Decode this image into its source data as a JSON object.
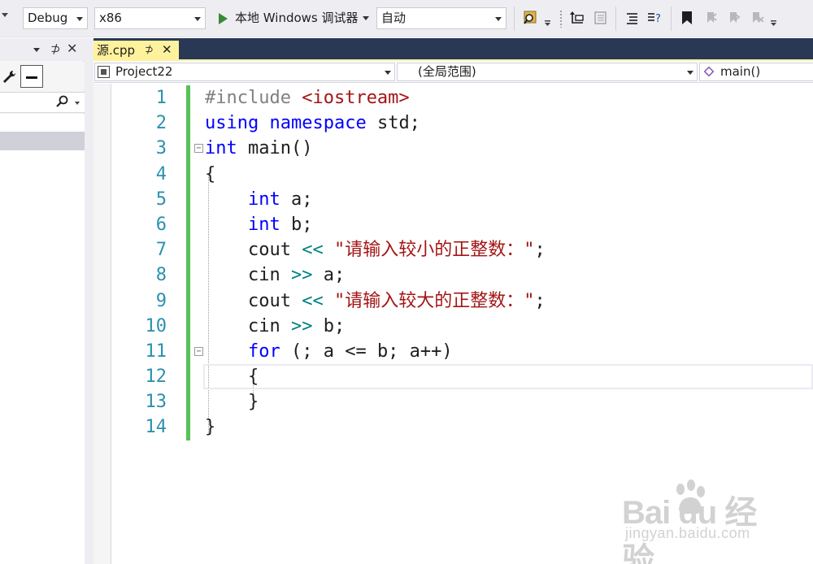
{
  "toolbar": {
    "config": "Debug",
    "platform": "x86",
    "run_label": "本地 Windows 调试器",
    "mode": "自动"
  },
  "tab": {
    "filename": "源.cpp",
    "pin": "⊅",
    "close": "✕"
  },
  "navbar": {
    "project": "Project22",
    "scope": "(全局范围)",
    "member": "main()"
  },
  "left_panel": {
    "pin": "⊅",
    "close": "✕"
  },
  "editor": {
    "line_numbers": [
      "1",
      "2",
      "3",
      "4",
      "5",
      "6",
      "7",
      "8",
      "9",
      "10",
      "11",
      "12",
      "13",
      "14"
    ],
    "code": [
      "#include <iostream>",
      "using namespace std;",
      "int main()",
      "{",
      "    int a;",
      "    int b;",
      "    cout << \"请输入较小的正整数：\";",
      "    cin >> a;",
      "    cout << \"请输入较大的正整数：\";",
      "    cin >> b;",
      "    for (; a <= b; a++)",
      "    {",
      "    }",
      "}"
    ],
    "current_line": 12
  },
  "watermark": {
    "main": "Bai  du 经验",
    "sub": "jingyan.baidu.com"
  },
  "colors": {
    "keyword": "#0000ff",
    "string": "#a31515",
    "operator": "#008080",
    "line_number": "#2b91af",
    "change_bar": "#57c257",
    "tab_active": "#fff29d",
    "tab_well": "#293955"
  }
}
